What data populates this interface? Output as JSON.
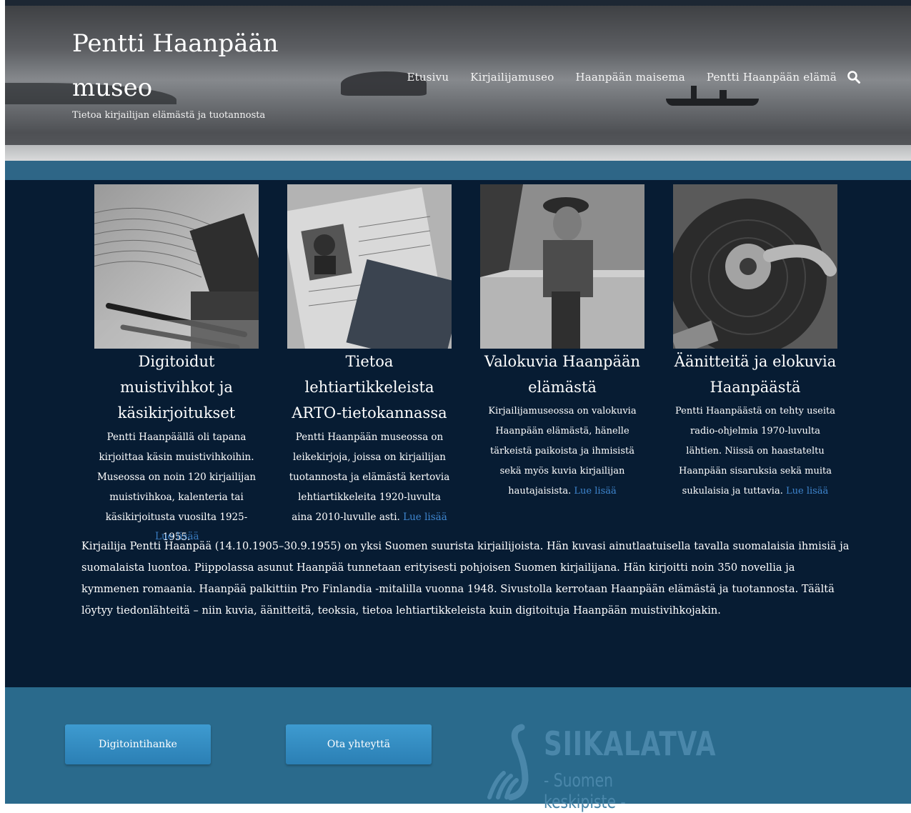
{
  "header": {
    "site_title": "Pentti Haanpään museo",
    "tagline": "Tietoa kirjailijan elämästä ja tuotannosta",
    "nav": [
      "Etusivu",
      "Kirjailijamuseo",
      "Haanpään maisema",
      "Pentti Haanpään elämä"
    ],
    "search_icon": "search-icon"
  },
  "cards": [
    {
      "title": "Digitoidut muistivihkot ja käsikirjoitukset",
      "text": "Pentti Haanpäällä oli tapana kirjoittaa käsin muistivihkoihin. Museossa on noin 120 kirjailijan muistivihkoa, kalenteria tai käsikirjoitusta vuosilta 1925-1955.",
      "more": "Lue lisää"
    },
    {
      "title": "Tietoa lehtiartikkeleista ARTO-tietokannassa",
      "text": "Pentti Haanpään museossa on leikekirjoja, joissa on kirjailijan tuotannosta ja elämästä kertovia lehtiartikkeleita 1920-luvulta aina 2010-luvulle asti.",
      "more": "Lue lisää"
    },
    {
      "title": "Valokuvia Haanpään elämästä",
      "text": "Kirjailijamuseossa on valokuvia Haanpään elämästä, hänelle tärkeistä paikoista ja ihmisistä sekä myös kuvia kirjailijan hautajaisista.",
      "more": "Lue lisää"
    },
    {
      "title": "Äänitteitä ja elokuvia Haanpäästä",
      "text": "Pentti Haanpäästä on tehty useita radio-ohjelmia 1970-luvulta lähtien. Niissä on haastateltu Haanpään sisaruksia sekä muita sukulaisia ja tuttavia.",
      "more": "Lue lisää"
    }
  ],
  "intro": "Kirjailija Pentti Haanpää (14.10.1905–30.9.1955) on yksi Suomen suurista kirjailijoista. Hän kuvasi ainutlaatuisella tavalla suomalaisia ihmisiä ja suomalaista luontoa. Piippolassa asunut Haanpää tunnetaan erityisesti pohjoisen Suomen kirjailijana. Hän kirjoitti noin 350 novellia ja kymmenen romaania. Haanpää palkittiin Pro Finlandia -mitalilla vuonna 1948. Sivustolla kerrotaan Haanpään elämästä ja tuotannosta. Täältä löytyy tiedonlähteitä – niin kuvia, äänitteitä, teoksia, tietoa lehtiartikkeleista kuin digitoituja Haanpään muistivihkojakin.",
  "footer": {
    "buttons": [
      "Digitointihanke",
      "Ota yhteyttä"
    ],
    "logo_word": "SIIKALATVA",
    "logo_sub": "- Suomen keskipiste -"
  },
  "colors": {
    "main_bg": "#071c33",
    "band": "#2e6687",
    "footer_bg": "#2a6a8c",
    "link": "#3f86cf",
    "button": "#3290c6"
  }
}
